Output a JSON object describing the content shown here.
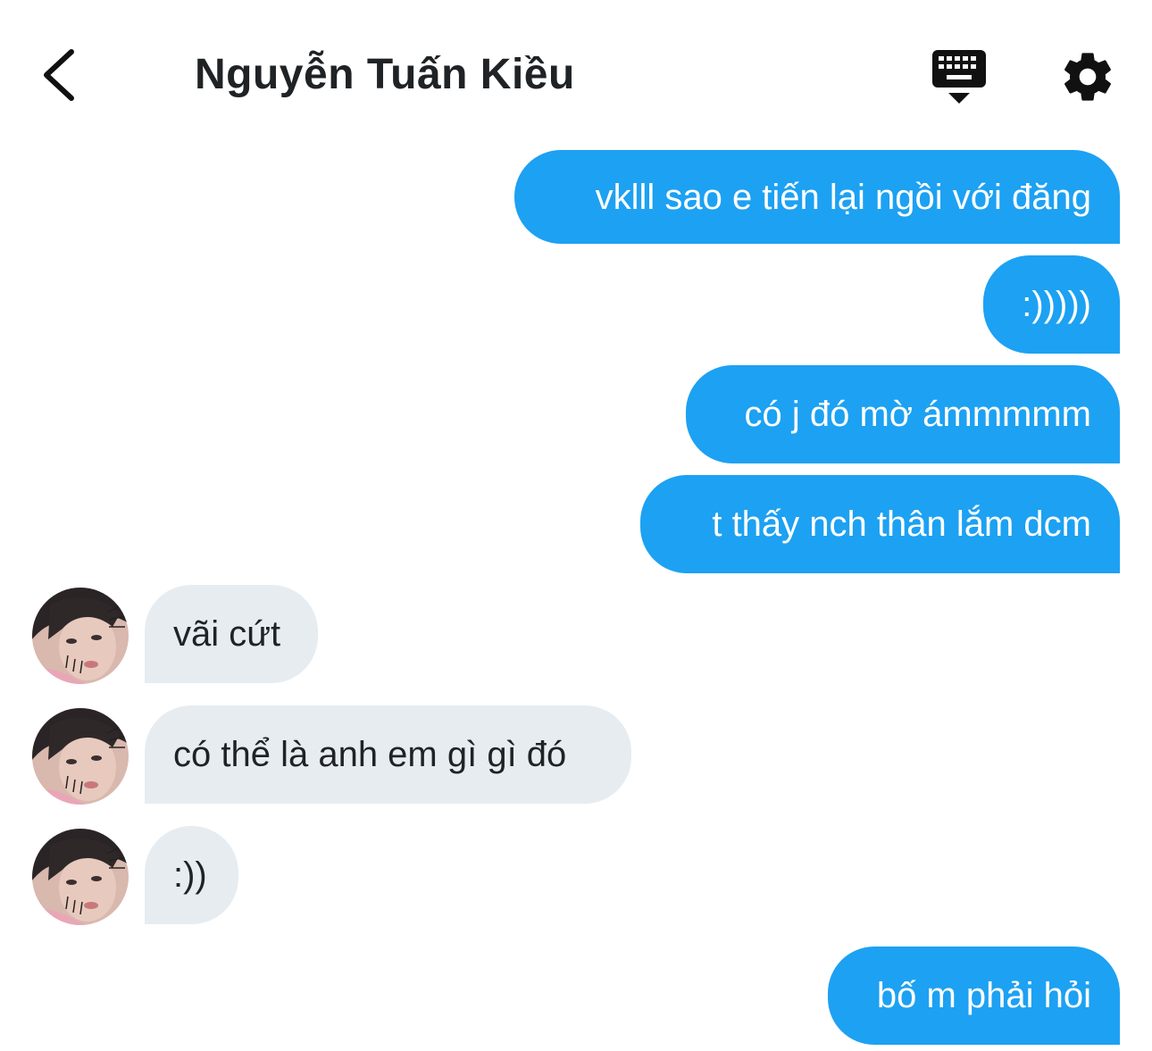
{
  "header": {
    "back_icon": "chevron-left-icon",
    "title": "Nguyễn Tuấn Kiều",
    "keyboard_icon": "keyboard-icon",
    "settings_icon": "gear-icon"
  },
  "colors": {
    "outgoing_bubble": "#1da1f2",
    "incoming_bubble": "#e6ecf0",
    "title_text": "#1f2326"
  },
  "messages": [
    {
      "direction": "outgoing",
      "text": "vklll sao e tiến lại ngồi với đăng"
    },
    {
      "direction": "outgoing",
      "text": ":)))))"
    },
    {
      "direction": "outgoing",
      "text": "có j đó mờ ámmmmm"
    },
    {
      "direction": "outgoing",
      "text": "t thấy nch thân lắm dcm"
    },
    {
      "direction": "incoming",
      "text": "vãi cứt"
    },
    {
      "direction": "incoming",
      "text": "có thể là anh em gì gì đó"
    },
    {
      "direction": "incoming",
      "text": ":))"
    },
    {
      "direction": "outgoing",
      "text": "bố m phải hỏi"
    }
  ]
}
